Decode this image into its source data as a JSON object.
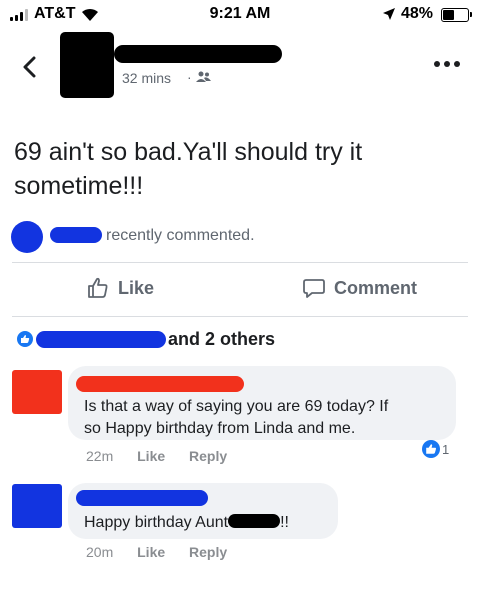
{
  "status_bar": {
    "carrier": "AT&T",
    "time": "9:21 AM",
    "battery": "48%",
    "battery_level": 0.48
  },
  "header": {
    "post_age": "32 mins",
    "separator": "·",
    "icons": {
      "back": "chevron-left-icon",
      "privacy": "friends-icon",
      "more": "more-options-icon"
    }
  },
  "post": {
    "text_line1": "69 ain't so bad.Ya'll should try it",
    "text_line2": "sometime!!!",
    "recent_activity": "recently commented."
  },
  "actions": {
    "like_label": "Like",
    "comment_label": "Comment"
  },
  "reactions": {
    "others_label": "and 2 others"
  },
  "comments": [
    {
      "text_line1": "Is that a way of saying you are 69 today?  If",
      "text_line2": "so Happy birthday from Linda and me.",
      "time": "22m",
      "like_label": "Like",
      "reply_label": "Reply",
      "reaction_count": "1",
      "avatar_color": "#f2311c",
      "name_color": "#f2311c"
    },
    {
      "text_prefix": "Happy birthday Aunt",
      "text_suffix": "!!",
      "time": "20m",
      "like_label": "Like",
      "reply_label": "Reply",
      "avatar_color": "#1234e0",
      "name_color": "#1234e0"
    }
  ],
  "colors": {
    "facebook_blue": "#1877f2",
    "redaction_blue": "#1234e0",
    "redaction_red": "#f2311c",
    "bubble_bg": "#f0f2f5",
    "secondary_text": "#606770"
  }
}
